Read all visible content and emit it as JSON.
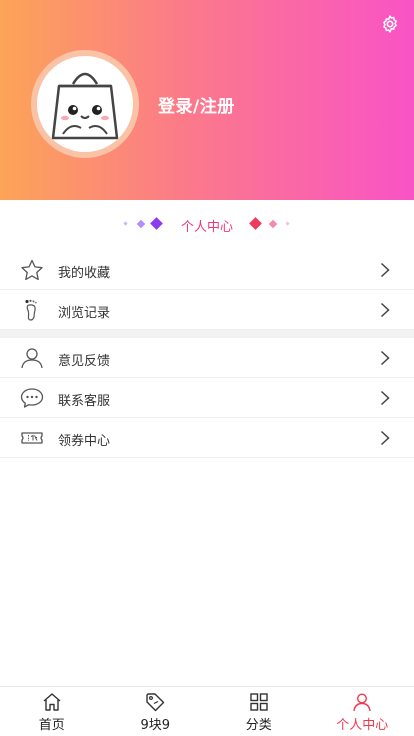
{
  "header": {
    "login_label": "登录/注册",
    "settings_icon": "gear-icon",
    "avatar_icon": "shopping-bag-mascot"
  },
  "section": {
    "title": "个人中心"
  },
  "menu": {
    "group1": [
      {
        "label": "我的收藏",
        "icon": "star-icon"
      },
      {
        "label": "浏览记录",
        "icon": "footprint-icon"
      }
    ],
    "group2": [
      {
        "label": "意见反馈",
        "icon": "user-icon"
      },
      {
        "label": "联系客服",
        "icon": "chat-icon"
      },
      {
        "label": "领券中心",
        "icon": "coupon-icon"
      }
    ]
  },
  "tabbar": {
    "tabs": [
      {
        "label": "首页",
        "icon": "home-icon"
      },
      {
        "label": "9块9",
        "icon": "tag-icon"
      },
      {
        "label": "分类",
        "icon": "grid-icon"
      },
      {
        "label": "个人中心",
        "icon": "person-icon",
        "active": true
      }
    ]
  },
  "colors": {
    "gradient_start": "#fca457",
    "gradient_end": "#f953c6",
    "accent": "#f0394c"
  }
}
